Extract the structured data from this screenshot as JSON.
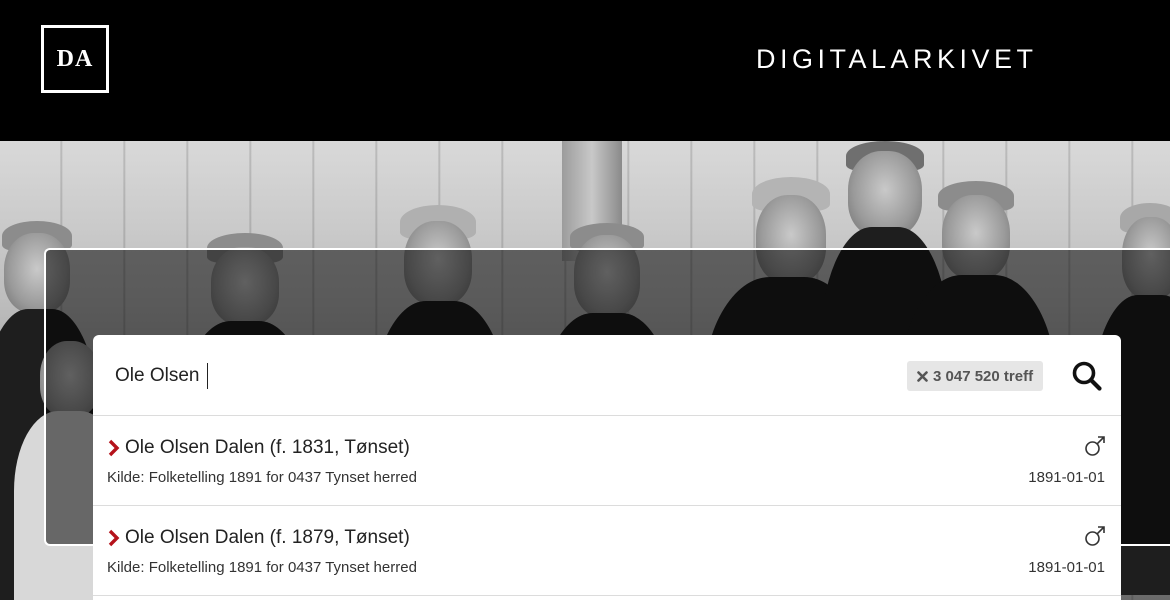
{
  "header": {
    "logo_text": "DA",
    "site_title": "DIGITALARKIVET"
  },
  "search": {
    "query": "Ole Olsen",
    "hit_count": "3 047 520 treff",
    "clear_icon": "close-icon",
    "search_icon": "search-icon"
  },
  "results": [
    {
      "name": "Ole Olsen Dalen (f. 1831, Tønset)",
      "source": "Kilde: Folketelling 1891 for 0437 Tynset herred",
      "gender_icon": "male-icon",
      "date": "1891-01-01"
    },
    {
      "name": "Ole Olsen Dalen (f. 1879, Tønset)",
      "source": "Kilde: Folketelling 1891 for 0437 Tynset herred",
      "gender_icon": "male-icon",
      "date": "1891-01-01"
    }
  ],
  "colors": {
    "header_bg": "#000000",
    "accent_chevron": "#b5121b",
    "badge_bg": "#e6e6e6"
  }
}
